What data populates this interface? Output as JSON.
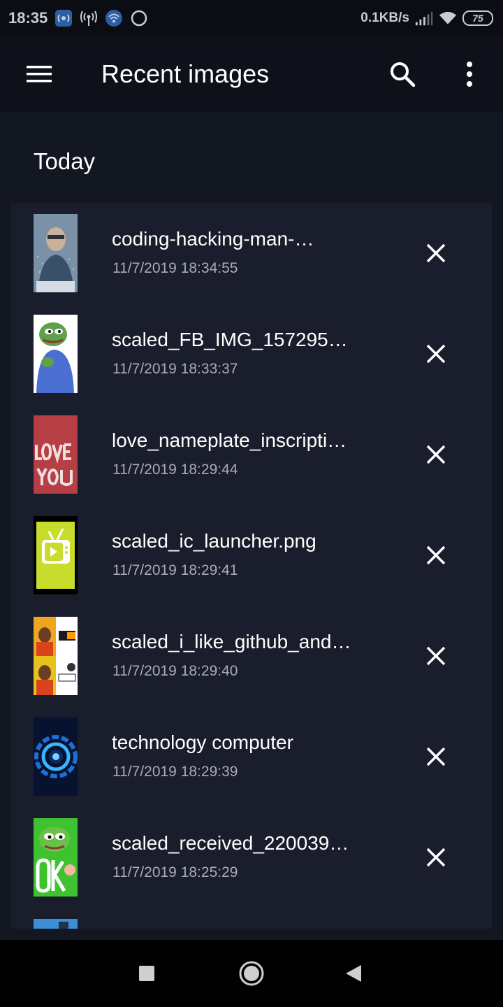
{
  "status_bar": {
    "time": "18:35",
    "net_speed": "0.1KB/s",
    "battery": "75"
  },
  "app_bar": {
    "title": "Recent images",
    "icons": [
      "menu-icon",
      "search-icon",
      "more-vert-icon"
    ]
  },
  "section": {
    "title": "Today"
  },
  "items": [
    {
      "name": "coding-hacking-man-…",
      "time": "11/7/2019 18:34:55",
      "thumb": "man-with-code"
    },
    {
      "name": "scaled_FB_IMG_157295…",
      "time": "11/7/2019 18:33:37",
      "thumb": "pepe-frog-hoodie"
    },
    {
      "name": "love_nameplate_inscripti…",
      "time": "11/7/2019 18:29:44",
      "thumb": "love-you-sign"
    },
    {
      "name": "scaled_ic_launcher.png",
      "time": "11/7/2019 18:29:41",
      "thumb": "tv-launcher-icon"
    },
    {
      "name": "scaled_i_like_github_and…",
      "time": "11/7/2019 18:29:40",
      "thumb": "drake-github-meme"
    },
    {
      "name": "technology computer",
      "time": "11/7/2019 18:29:39",
      "thumb": "blue-tech-circle"
    },
    {
      "name": "scaled_received_220039…",
      "time": "11/7/2019 18:25:29",
      "thumb": "pepe-ok"
    }
  ],
  "nav_bar": {
    "icons": [
      "recents-icon",
      "home-icon",
      "back-icon"
    ]
  },
  "colors": {
    "background": "#131722",
    "app_bar": "#0e111a",
    "card": "#1a1d2b",
    "secondary_text": "#a8acb6"
  }
}
